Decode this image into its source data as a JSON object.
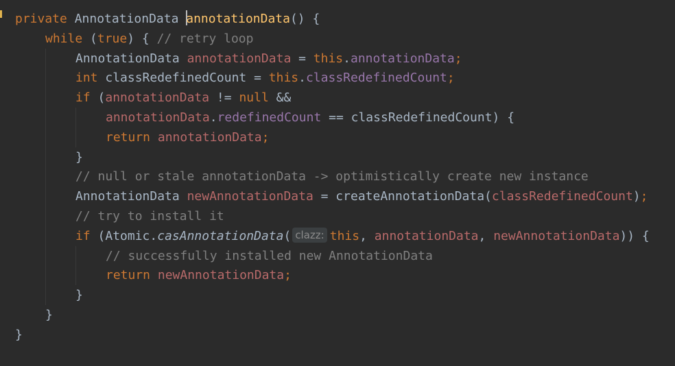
{
  "editor": {
    "lines": [
      {
        "indent": 0,
        "tokens": [
          {
            "t": "private",
            "c": "kw"
          },
          {
            "t": " AnnotationData "
          },
          {
            "caret": true
          },
          {
            "t": "annotationData",
            "c": "fn"
          },
          {
            "t": "() {"
          }
        ]
      },
      {
        "indent": 2,
        "tokens": [
          {
            "t": "while",
            "c": "kw"
          },
          {
            "t": " ("
          },
          {
            "t": "true",
            "c": "kw"
          },
          {
            "t": ") { "
          },
          {
            "t": "// retry loop",
            "c": "cm"
          }
        ]
      },
      {
        "indent": 4,
        "tokens": [
          {
            "t": "AnnotationData "
          },
          {
            "t": "annotationData",
            "c": "uv"
          },
          {
            "t": " = "
          },
          {
            "t": "this",
            "c": "kw"
          },
          {
            "t": "."
          },
          {
            "t": "annotationData",
            "c": "fld"
          },
          {
            "t": ";",
            "c": "kw"
          }
        ]
      },
      {
        "indent": 4,
        "tokens": [
          {
            "t": "int",
            "c": "kw"
          },
          {
            "t": " classRedefinedCount = "
          },
          {
            "t": "this",
            "c": "kw"
          },
          {
            "t": "."
          },
          {
            "t": "classRedefinedCount",
            "c": "fld"
          },
          {
            "t": ";",
            "c": "kw"
          }
        ]
      },
      {
        "indent": 4,
        "tokens": [
          {
            "t": "if",
            "c": "kw"
          },
          {
            "t": " ("
          },
          {
            "t": "annotationData",
            "c": "uv"
          },
          {
            "t": " != "
          },
          {
            "t": "null",
            "c": "kw"
          },
          {
            "t": " &&"
          }
        ]
      },
      {
        "indent": 6,
        "tokens": [
          {
            "t": "annotationData",
            "c": "uv"
          },
          {
            "t": "."
          },
          {
            "t": "redefinedCount",
            "c": "fld"
          },
          {
            "t": " == classRedefinedCount) {"
          }
        ]
      },
      {
        "indent": 6,
        "tokens": [
          {
            "t": "return",
            "c": "kw"
          },
          {
            "t": " "
          },
          {
            "t": "annotationData",
            "c": "uv"
          },
          {
            "t": ";",
            "c": "kw"
          }
        ]
      },
      {
        "indent": 4,
        "tokens": [
          {
            "t": "}"
          }
        ]
      },
      {
        "indent": 4,
        "tokens": [
          {
            "t": "// null or stale annotationData -> optimistically create new instance",
            "c": "cm"
          }
        ]
      },
      {
        "indent": 4,
        "tokens": [
          {
            "t": "AnnotationData "
          },
          {
            "t": "newAnnotationData",
            "c": "uv"
          },
          {
            "t": " = createAnnotationData("
          },
          {
            "t": "classRedefinedCount",
            "c": "uv"
          },
          {
            "t": ")"
          },
          {
            "t": ";",
            "c": "kw"
          }
        ]
      },
      {
        "indent": 4,
        "tokens": [
          {
            "t": "// try to install it",
            "c": "cm"
          }
        ]
      },
      {
        "indent": 4,
        "tokens": [
          {
            "t": "if",
            "c": "kw"
          },
          {
            "t": " (Atomic."
          },
          {
            "t": "casAnnotationData",
            "c": "it"
          },
          {
            "t": "("
          },
          {
            "hint": "clazz:"
          },
          {
            "t": "this",
            "c": "kw"
          },
          {
            "t": ", "
          },
          {
            "t": "annotationData",
            "c": "uv"
          },
          {
            "t": ", "
          },
          {
            "t": "newAnnotationData",
            "c": "uv"
          },
          {
            "t": ")) {"
          }
        ]
      },
      {
        "indent": 6,
        "tokens": [
          {
            "t": "// successfully installed new AnnotationData",
            "c": "cm"
          }
        ]
      },
      {
        "indent": 6,
        "tokens": [
          {
            "t": "return",
            "c": "kw"
          },
          {
            "t": " "
          },
          {
            "t": "newAnnotationData",
            "c": "uv"
          },
          {
            "t": ";",
            "c": "kw"
          }
        ]
      },
      {
        "indent": 4,
        "tokens": [
          {
            "t": "}"
          }
        ]
      },
      {
        "indent": 2,
        "tokens": [
          {
            "t": "}"
          }
        ]
      },
      {
        "indent": 0,
        "tokens": [
          {
            "t": "}"
          }
        ]
      }
    ]
  },
  "colors": {
    "background": "#2b2b2b",
    "keyword": "#cc7832",
    "comment": "#808080",
    "field": "#9876aa",
    "method": "#ffc66d",
    "variable": "#b96a6a",
    "plain": "#a9b7c6"
  },
  "icons": {
    "gutter_marker": "bookmark-marker-icon"
  }
}
